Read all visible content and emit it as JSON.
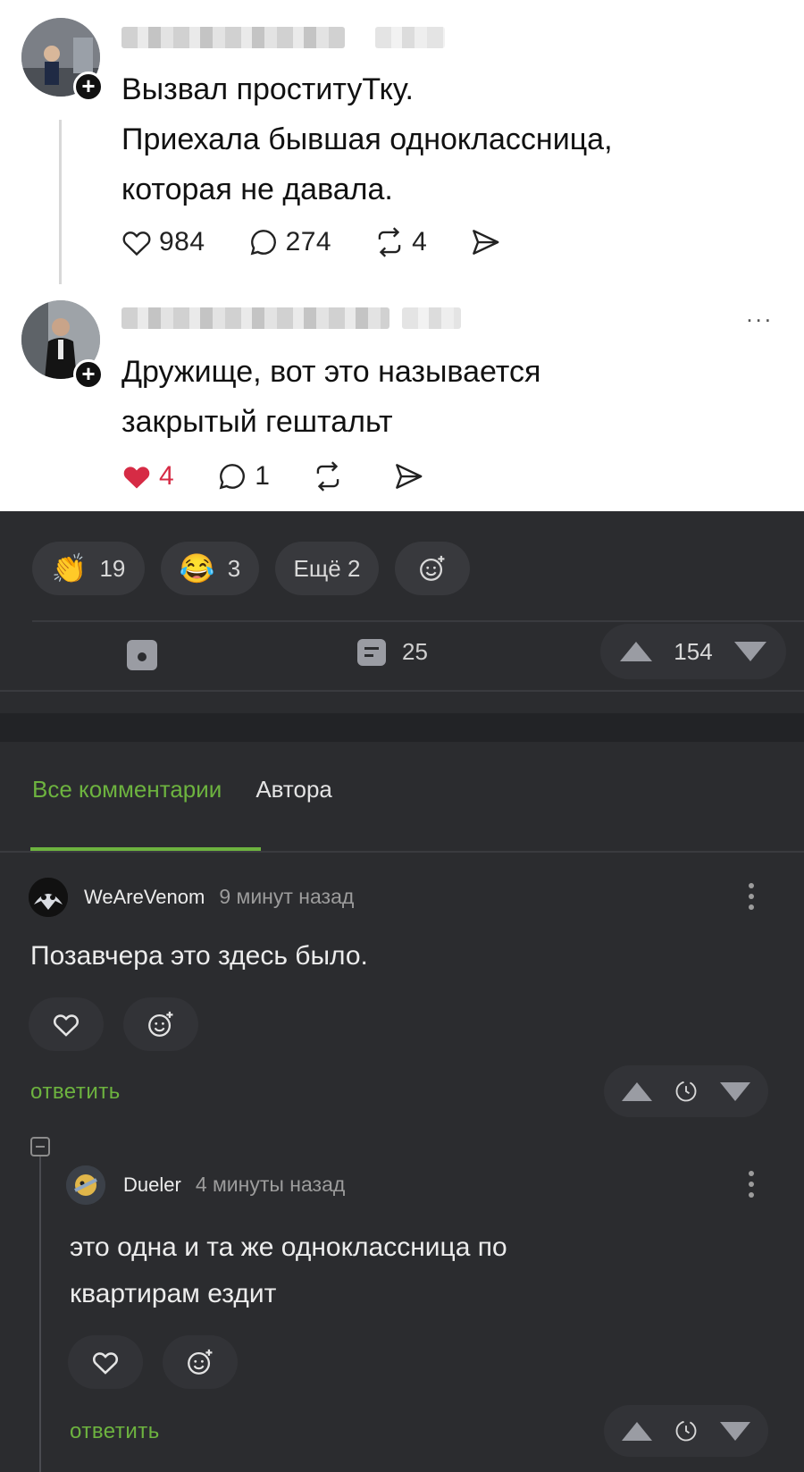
{
  "post1": {
    "text_lines": [
      "Вызвал проституТку.",
      "Приехала бывшая одноклассница,",
      "которая не давала."
    ],
    "likes": "984",
    "comments": "274",
    "reposts": "4"
  },
  "post2": {
    "text_lines": [
      "Дружище, вот это называется",
      "закрытый гештальт"
    ],
    "likes": "4",
    "comments": "1",
    "more": "..."
  },
  "reactions": [
    {
      "emoji": "👏",
      "count": "19"
    },
    {
      "emoji": "😂",
      "count": "3"
    },
    {
      "label": "Ещё 2"
    }
  ],
  "stats": {
    "comments_count": "25",
    "rating": "154"
  },
  "tabs": {
    "all": "Все комментарии",
    "author": "Автора"
  },
  "comments": [
    {
      "user": "WeAreVenom",
      "time": "9 минут назад",
      "text_lines": [
        "Позавчера это здесь было."
      ],
      "reply_label": "ответить"
    },
    {
      "user": "Dueler",
      "time": "4 минуты назад",
      "text_lines": [
        "это одна и та же одноклассница по",
        "квартирам ездит"
      ],
      "reply_label": "ответить"
    }
  ],
  "colors": {
    "accent_green": "#6db33f",
    "like_red": "#d62b45",
    "dark_bg": "#2b2c2f"
  }
}
